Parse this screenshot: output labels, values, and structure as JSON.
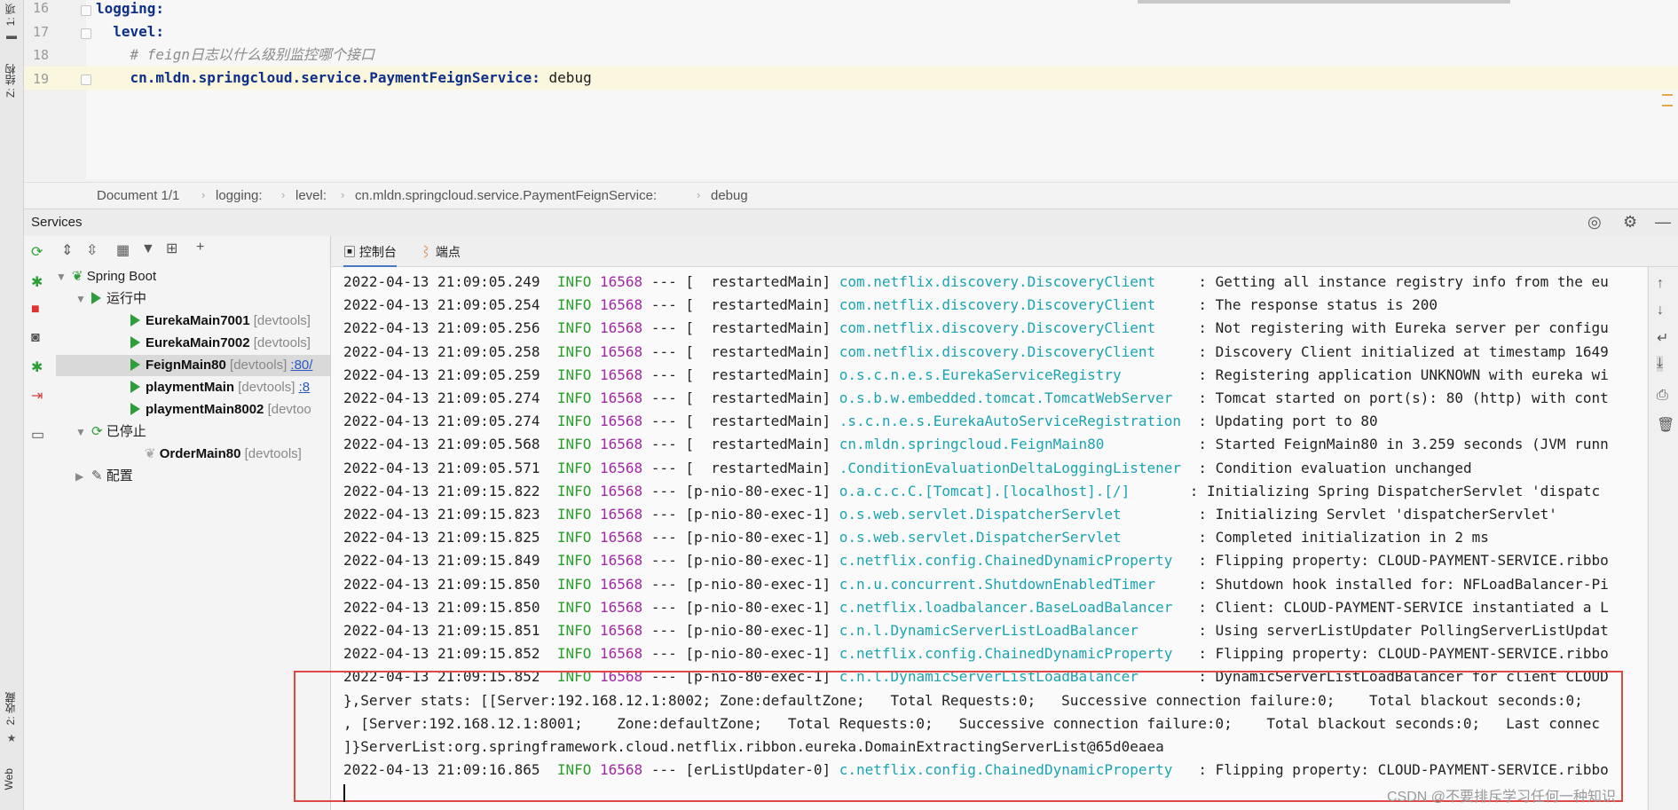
{
  "left_strip": {
    "top_label": "1: 项",
    "structure_label": "Z: 结构",
    "favorites_label": "2: 收藏",
    "web_label": "Web"
  },
  "editor": {
    "lines": [
      {
        "num": "16",
        "key": "logging:",
        "value": ""
      },
      {
        "num": "17",
        "key": "  level:",
        "value": ""
      },
      {
        "num": "18",
        "comment": "    # feign日志以什么级别监控哪个接口"
      },
      {
        "num": "19",
        "key": "    cn.mldn.springcloud.service.PaymentFeignService:",
        "value": " debug"
      }
    ]
  },
  "breadcrumb": {
    "items": [
      "Document 1/1",
      "logging:",
      "level:",
      "cn.mldn.springcloud.service.PaymentFeignService:",
      "debug"
    ]
  },
  "services": {
    "title": "Services",
    "tree": {
      "spring_boot": "Spring Boot",
      "running": "运行中",
      "stopped": "已停止",
      "config": "配置",
      "running_items": [
        {
          "name": "EurekaMain7001",
          "tag": "[devtools]",
          "port": ""
        },
        {
          "name": "EurekaMain7002",
          "tag": "[devtools]",
          "port": ""
        },
        {
          "name": "FeignMain80",
          "tag": "[devtools]",
          "port": ":80/"
        },
        {
          "name": "playmentMain",
          "tag": "[devtools]",
          "port": ":8"
        },
        {
          "name": "playmentMain8002",
          "tag": "[devtoo",
          "port": ""
        }
      ],
      "stopped_items": [
        {
          "name": "OrderMain80",
          "tag": "[devtools]"
        }
      ]
    }
  },
  "console": {
    "tabs": [
      "控制台",
      "端点"
    ],
    "lines": [
      {
        "ts": "2022-04-13 21:09:05.249",
        "level": "INFO",
        "pid": "16568",
        "thread": "--- [  restartedMain]",
        "logger": "com.netflix.discovery.DiscoveryClient    ",
        "msg": ": Getting all instance registry info from the eu"
      },
      {
        "ts": "2022-04-13 21:09:05.254",
        "level": "INFO",
        "pid": "16568",
        "thread": "--- [  restartedMain]",
        "logger": "com.netflix.discovery.DiscoveryClient    ",
        "msg": ": The response status is 200"
      },
      {
        "ts": "2022-04-13 21:09:05.256",
        "level": "INFO",
        "pid": "16568",
        "thread": "--- [  restartedMain]",
        "logger": "com.netflix.discovery.DiscoveryClient    ",
        "msg": ": Not registering with Eureka server per configu"
      },
      {
        "ts": "2022-04-13 21:09:05.258",
        "level": "INFO",
        "pid": "16568",
        "thread": "--- [  restartedMain]",
        "logger": "com.netflix.discovery.DiscoveryClient    ",
        "msg": ": Discovery Client initialized at timestamp 1649"
      },
      {
        "ts": "2022-04-13 21:09:05.259",
        "level": "INFO",
        "pid": "16568",
        "thread": "--- [  restartedMain]",
        "logger": "o.s.c.n.e.s.EurekaServiceRegistry        ",
        "msg": ": Registering application UNKNOWN with eureka wi"
      },
      {
        "ts": "2022-04-13 21:09:05.274",
        "level": "INFO",
        "pid": "16568",
        "thread": "--- [  restartedMain]",
        "logger": "o.s.b.w.embedded.tomcat.TomcatWebServer  ",
        "msg": ": Tomcat started on port(s): 80 (http) with cont"
      },
      {
        "ts": "2022-04-13 21:09:05.274",
        "level": "INFO",
        "pid": "16568",
        "thread": "--- [  restartedMain]",
        "logger": ".s.c.n.e.s.EurekaAutoServiceRegistration ",
        "msg": ": Updating port to 80"
      },
      {
        "ts": "2022-04-13 21:09:05.568",
        "level": "INFO",
        "pid": "16568",
        "thread": "--- [  restartedMain]",
        "logger": "cn.mldn.springcloud.FeignMain80          ",
        "msg": ": Started FeignMain80 in 3.259 seconds (JVM runn"
      },
      {
        "ts": "2022-04-13 21:09:05.571",
        "level": "INFO",
        "pid": "16568",
        "thread": "--- [  restartedMain]",
        "logger": ".ConditionEvaluationDeltaLoggingListener ",
        "msg": ": Condition evaluation unchanged"
      },
      {
        "ts": "2022-04-13 21:09:15.822",
        "level": "INFO",
        "pid": "16568",
        "thread": "--- [p-nio-80-exec-1]",
        "logger": "o.a.c.c.C.[Tomcat].[localhost].[/]      ",
        "msg": ": Initializing Spring DispatcherServlet 'dispatc"
      },
      {
        "ts": "2022-04-13 21:09:15.823",
        "level": "INFO",
        "pid": "16568",
        "thread": "--- [p-nio-80-exec-1]",
        "logger": "o.s.web.servlet.DispatcherServlet        ",
        "msg": ": Initializing Servlet 'dispatcherServlet'"
      },
      {
        "ts": "2022-04-13 21:09:15.825",
        "level": "INFO",
        "pid": "16568",
        "thread": "--- [p-nio-80-exec-1]",
        "logger": "o.s.web.servlet.DispatcherServlet        ",
        "msg": ": Completed initialization in 2 ms"
      },
      {
        "ts": "2022-04-13 21:09:15.849",
        "level": "INFO",
        "pid": "16568",
        "thread": "--- [p-nio-80-exec-1]",
        "logger": "c.netflix.config.ChainedDynamicProperty  ",
        "msg": ": Flipping property: CLOUD-PAYMENT-SERVICE.ribbo"
      },
      {
        "ts": "2022-04-13 21:09:15.850",
        "level": "INFO",
        "pid": "16568",
        "thread": "--- [p-nio-80-exec-1]",
        "logger": "c.n.u.concurrent.ShutdownEnabledTimer    ",
        "msg": ": Shutdown hook installed for: NFLoadBalancer-Pi"
      },
      {
        "ts": "2022-04-13 21:09:15.850",
        "level": "INFO",
        "pid": "16568",
        "thread": "--- [p-nio-80-exec-1]",
        "logger": "c.netflix.loadbalancer.BaseLoadBalancer  ",
        "msg": ": Client: CLOUD-PAYMENT-SERVICE instantiated a L"
      },
      {
        "ts": "2022-04-13 21:09:15.851",
        "level": "INFO",
        "pid": "16568",
        "thread": "--- [p-nio-80-exec-1]",
        "logger": "c.n.l.DynamicServerListLoadBalancer      ",
        "msg": ": Using serverListUpdater PollingServerListUpdat"
      },
      {
        "ts": "2022-04-13 21:09:15.852",
        "level": "INFO",
        "pid": "16568",
        "thread": "--- [p-nio-80-exec-1]",
        "logger": "c.netflix.config.ChainedDynamicProperty  ",
        "msg": ": Flipping property: CLOUD-PAYMENT-SERVICE.ribbo"
      },
      {
        "ts": "2022-04-13 21:09:15.852",
        "level": "INFO",
        "pid": "16568",
        "thread": "--- [p-nio-80-exec-1]",
        "logger": "c.n.l.DynamicServerListLoadBalancer      ",
        "msg": ": DynamicServerListLoadBalancer for client CLOUD"
      },
      {
        "plain": "},Server stats: [[Server:192.168.12.1:8002; Zone:defaultZone;   Total Requests:0;   Successive connection failure:0;    Total blackout seconds:0;"
      },
      {
        "plain": ", [Server:192.168.12.1:8001;    Zone:defaultZone;   Total Requests:0;   Successive connection failure:0;    Total blackout seconds:0;   Last connec"
      },
      {
        "plain": "]}ServerList:org.springframework.cloud.netflix.ribbon.eureka.DomainExtractingServerList@65d0eaea"
      },
      {
        "ts": "2022-04-13 21:09:16.865",
        "level": "INFO",
        "pid": "16568",
        "thread": "--- [erListUpdater-0]",
        "logger": "c.netflix.config.ChainedDynamicProperty  ",
        "msg": ": Flipping property: CLOUD-PAYMENT-SERVICE.ribbo"
      }
    ]
  },
  "watermark": "CSDN @不要排斥学习任何一种知识",
  "colors": {
    "info": "#2c9e2c",
    "pid": "#a02aa0",
    "logger": "#1aa3b0",
    "highlight_box": "#e04848",
    "yaml_key": "#0e2f87",
    "running_triangle": "#2f9e3a"
  }
}
